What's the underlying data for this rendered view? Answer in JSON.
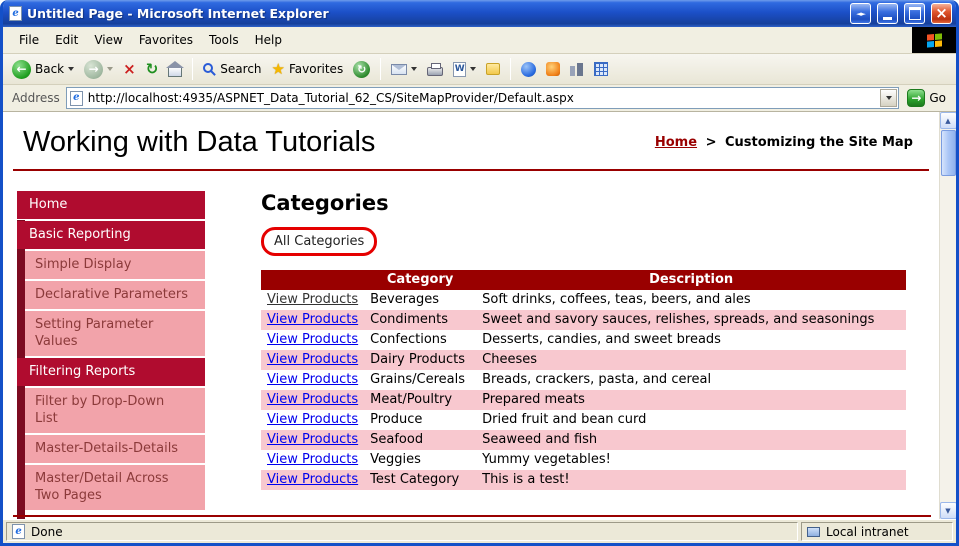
{
  "colors": {
    "accent-maroon": "#990000",
    "window-border-blue": "#1450c8",
    "sidebar-l1-bg": "#b00c2f",
    "sidebar-strip": "#7c0a20",
    "sidebar-l2-bg": "#f2a3aa",
    "sidebar-l2-text": "#8b3a3a",
    "table-header-bg": "#990000",
    "table-alt-row-bg": "#f8c8cf",
    "link-blue": "#0000ee",
    "annotation-red": "#e50000",
    "go-green": "#2ba12b"
  },
  "icons": {
    "ie": "e",
    "window_arrows": "◄►",
    "close": "×",
    "back_arrow": "←",
    "forward_arrow": "→",
    "stop": "×",
    "refresh": "↻",
    "favorites_star": "★",
    "history": "↻",
    "edit_w": "W",
    "go_arrow": "→",
    "scroll_up": "▲",
    "scroll_down": "▼"
  },
  "window": {
    "title": "Untitled Page - Microsoft Internet Explorer"
  },
  "menu_bar": {
    "items": [
      "File",
      "Edit",
      "View",
      "Favorites",
      "Tools",
      "Help"
    ]
  },
  "toolbar": {
    "back_label": "Back",
    "search_label": "Search",
    "favorites_label": "Favorites"
  },
  "address_bar": {
    "label": "Address",
    "url": "http://localhost:4935/ASPNET_Data_Tutorial_62_CS/SiteMapProvider/Default.aspx",
    "go_label": "Go"
  },
  "page": {
    "title": "Working with Data Tutorials",
    "breadcrumb": {
      "home_link": "Home",
      "separator": ">",
      "current": "Customizing the Site Map"
    },
    "sidebar": {
      "items": [
        {
          "label": "Home",
          "level": 1
        },
        {
          "label": "Basic Reporting",
          "level": 1
        },
        {
          "label": "Simple Display",
          "level": 2
        },
        {
          "label": "Declarative Parameters",
          "level": 2
        },
        {
          "label": "Setting Parameter Values",
          "level": 2
        },
        {
          "label": "Filtering Reports",
          "level": 1
        },
        {
          "label": "Filter by Drop-Down List",
          "level": 2
        },
        {
          "label": "Master-Details-Details",
          "level": 2
        },
        {
          "label": "Master/Detail Across Two Pages",
          "level": 2
        }
      ]
    },
    "main": {
      "heading": "Categories",
      "filter_menu_item": "All Categories",
      "table": {
        "link_label": "View Products",
        "headers": [
          "",
          "Category",
          "Description"
        ],
        "rows": [
          {
            "category": "Beverages",
            "description": "Soft drinks, coffees, teas, beers, and ales"
          },
          {
            "category": "Condiments",
            "description": "Sweet and savory sauces, relishes, spreads, and seasonings"
          },
          {
            "category": "Confections",
            "description": "Desserts, candies, and sweet breads"
          },
          {
            "category": "Dairy Products",
            "description": "Cheeses"
          },
          {
            "category": "Grains/Cereals",
            "description": "Breads, crackers, pasta, and cereal"
          },
          {
            "category": "Meat/Poultry",
            "description": "Prepared meats"
          },
          {
            "category": "Produce",
            "description": "Dried fruit and bean curd"
          },
          {
            "category": "Seafood",
            "description": "Seaweed and fish"
          },
          {
            "category": "Veggies",
            "description": "Yummy vegetables!"
          },
          {
            "category": "Test Category",
            "description": "This is a test!"
          }
        ]
      }
    }
  },
  "status_bar": {
    "status": "Done",
    "zone": "Local intranet"
  }
}
